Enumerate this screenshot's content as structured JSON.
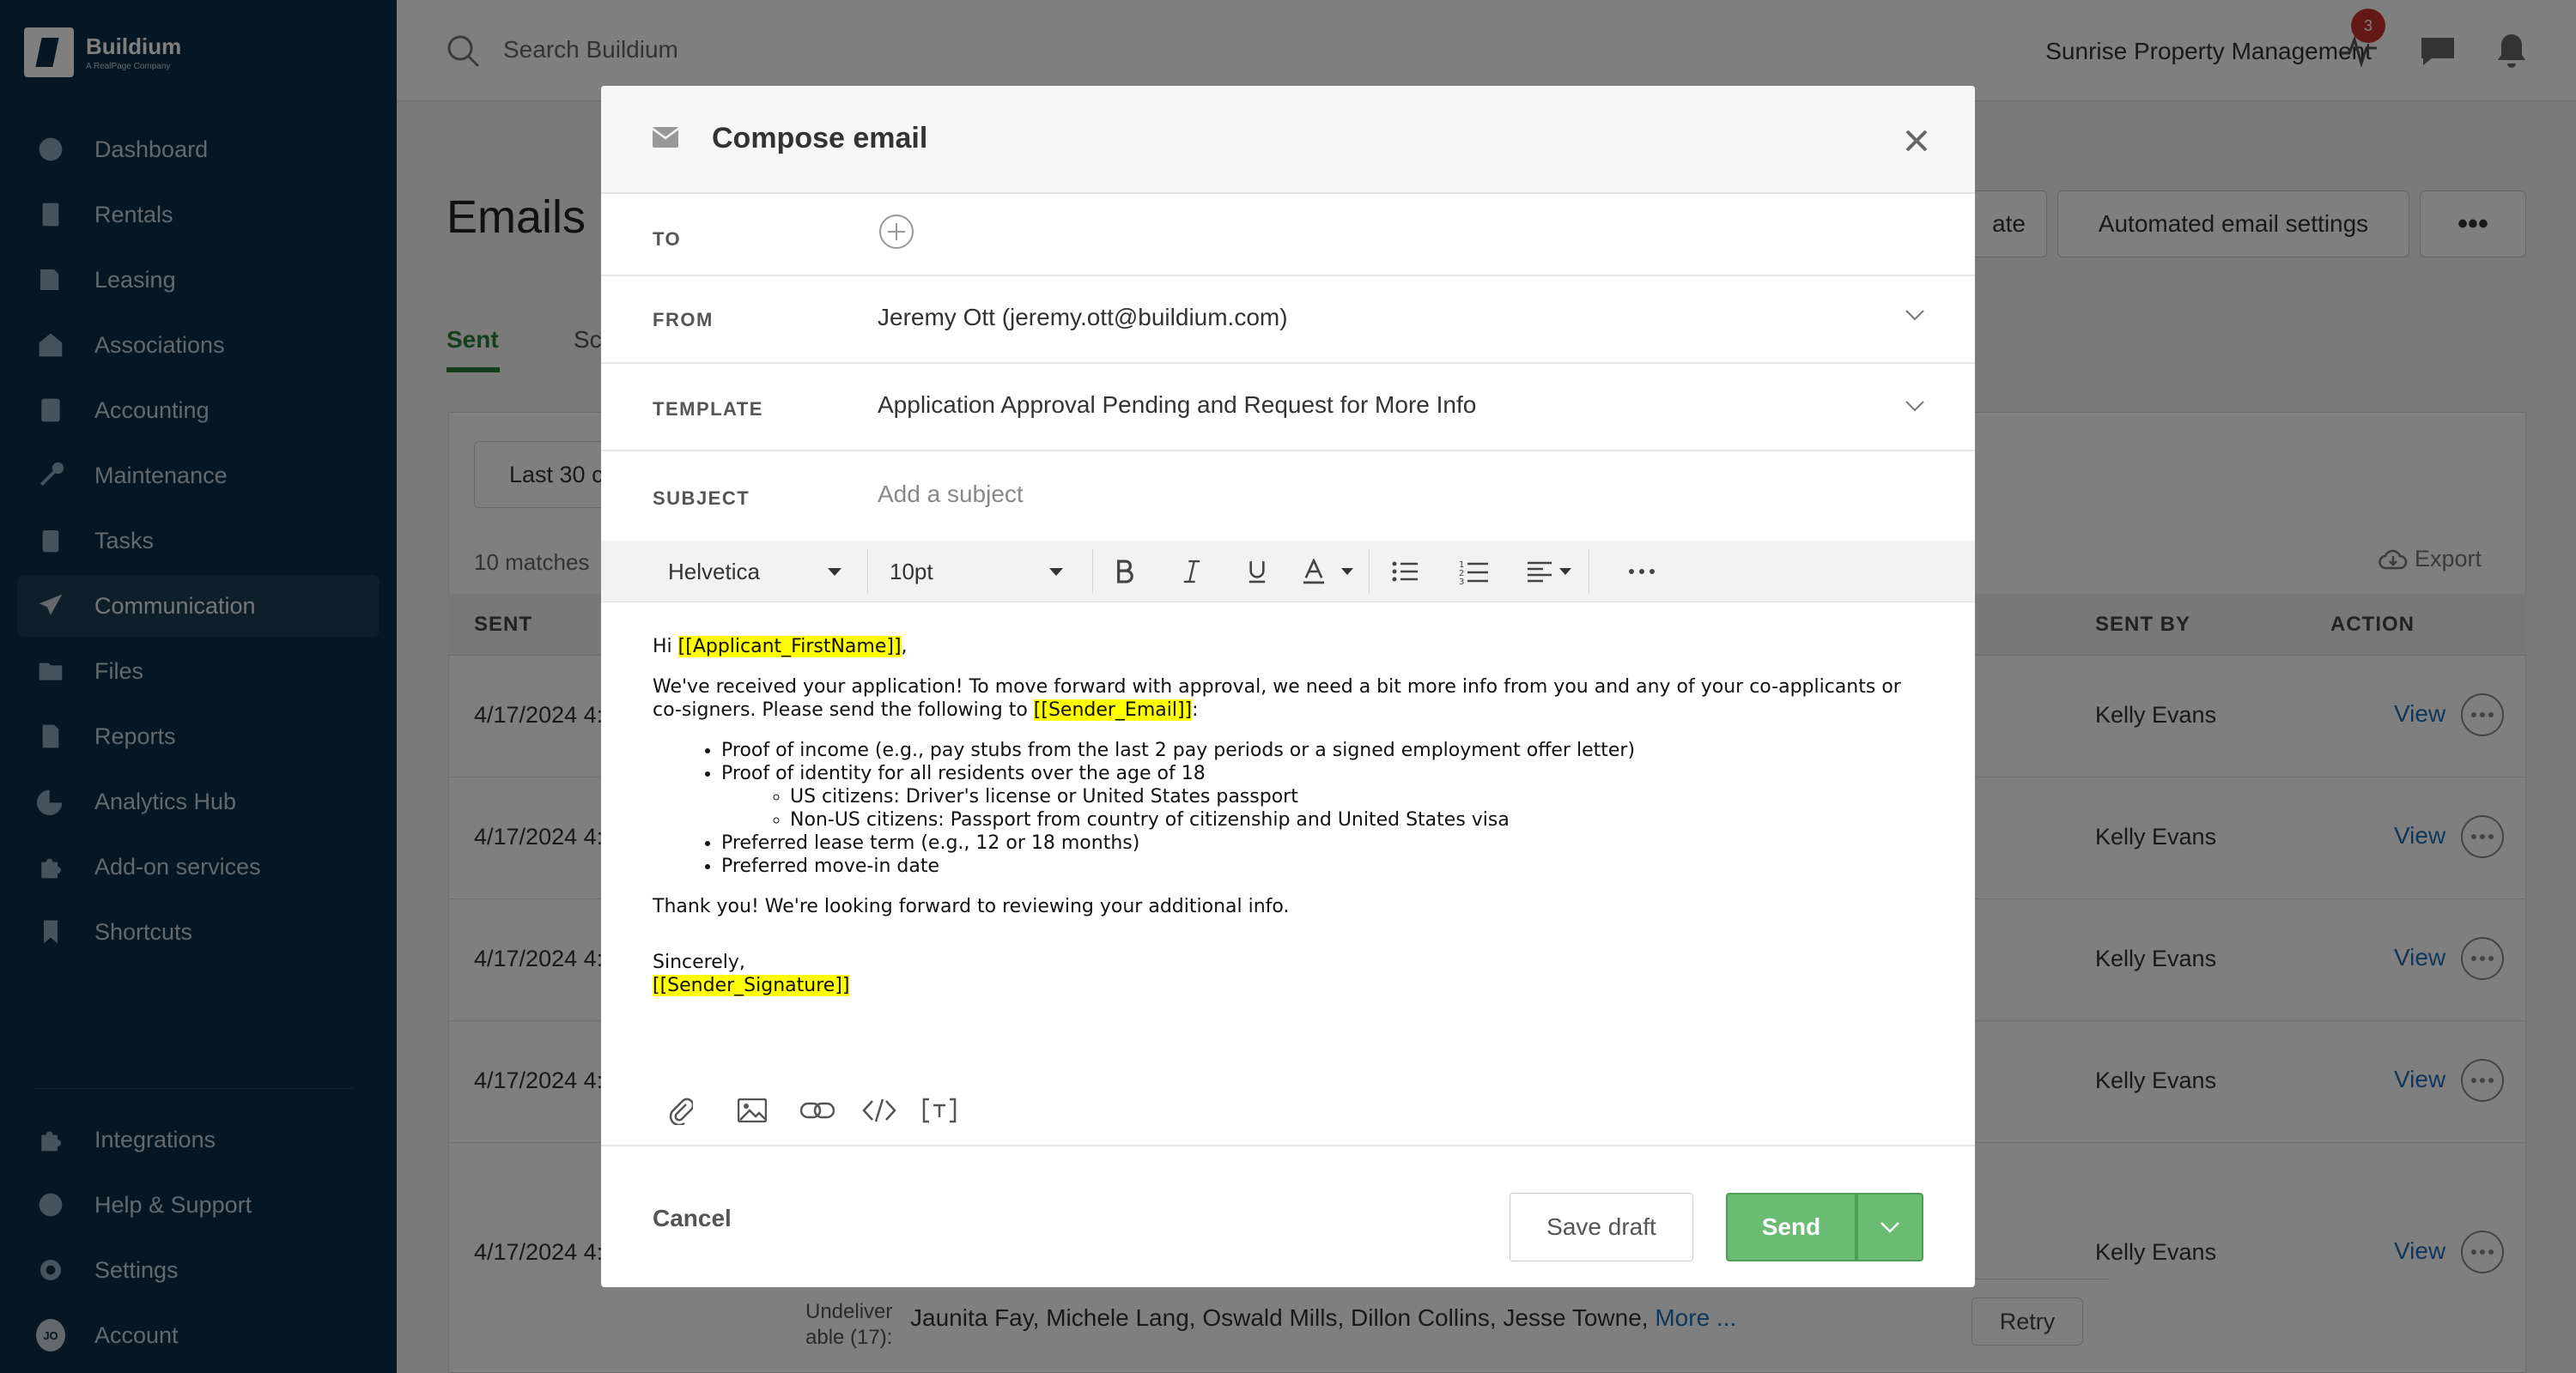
{
  "brand": {
    "name": "Buildium",
    "sub": "A RealPage Company"
  },
  "sidebar": {
    "items": [
      {
        "label": "Dashboard",
        "icon": "dashboard-icon"
      },
      {
        "label": "Rentals",
        "icon": "building-icon"
      },
      {
        "label": "Leasing",
        "icon": "leasing-icon"
      },
      {
        "label": "Associations",
        "icon": "associations-icon"
      },
      {
        "label": "Accounting",
        "icon": "calculator-icon"
      },
      {
        "label": "Maintenance",
        "icon": "wrench-icon"
      },
      {
        "label": "Tasks",
        "icon": "clipboard-icon"
      },
      {
        "label": "Communication",
        "icon": "paper-plane-icon",
        "active": true
      },
      {
        "label": "Files",
        "icon": "folder-icon"
      },
      {
        "label": "Reports",
        "icon": "report-icon"
      },
      {
        "label": "Analytics Hub",
        "icon": "pie-chart-icon"
      },
      {
        "label": "Add-on services",
        "icon": "puzzle-icon"
      },
      {
        "label": "Shortcuts",
        "icon": "bookmark-icon"
      }
    ],
    "bottom": [
      {
        "label": "Integrations",
        "icon": "puzzle-icon"
      },
      {
        "label": "Help & Support",
        "icon": "help-icon"
      },
      {
        "label": "Settings",
        "icon": "gear-icon"
      },
      {
        "label": "Account",
        "icon": "avatar",
        "initials": "JO"
      }
    ]
  },
  "header": {
    "search_placeholder": "Search Buildium",
    "org_name": "Sunrise Property Management",
    "notification_count": "3"
  },
  "page": {
    "title": "Emails",
    "btn_template_partial": "ate",
    "btn_automated": "Automated email settings",
    "tab_sent": "Sent",
    "tab_partial": "Sc",
    "filter_partial": "Last 30 c",
    "matches_partial": "10 matches",
    "export_label": "Export",
    "columns": {
      "sent": "SENT",
      "sent_by": "SENT BY",
      "action": "ACTION"
    },
    "rows": [
      {
        "sent": "4/17/2024 4:",
        "sent_by": "Kelly Evans",
        "action": "View"
      },
      {
        "sent": "4/17/2024 4:",
        "sent_by": "Kelly Evans",
        "action": "View"
      },
      {
        "sent": "4/17/2024 4:",
        "sent_by": "Kelly Evans",
        "action": "View"
      },
      {
        "sent": "4/17/2024 4:",
        "sent_by": "Kelly Evans",
        "action": "View"
      },
      {
        "sent": "4/17/2024 4:",
        "sent_by": "Kelly Evans",
        "action": "View"
      }
    ],
    "undeliverable_label": "Undeliver able (17):",
    "undeliverable_names": "Jaunita Fay, Michele Lang, Oswald Mills, Dillon Collins, Jesse Towne,",
    "undeliverable_more": "More ...",
    "retry": "Retry"
  },
  "modal": {
    "title": "Compose email",
    "to_label": "TO",
    "from_label": "FROM",
    "from_value": "Jeremy Ott (jeremy.ott@buildium.com)",
    "template_label": "TEMPLATE",
    "template_value": "Application Approval Pending and Request for More Info",
    "subject_label": "SUBJECT",
    "subject_placeholder": "Add a subject",
    "toolbar": {
      "font": "Helvetica",
      "size": "10pt"
    },
    "body": {
      "greeting_pre": "Hi ",
      "greeting_tag": "[[Applicant_FirstName]]",
      "greeting_post": ",",
      "para1": "We've received your application! To move forward with approval, we need a bit more info from you and any of your co-applicants or co-signers. Please send the following to ",
      "para1_tag": "[[Sender_Email]]",
      "para1_post": ":",
      "li1": "Proof of income (e.g., pay stubs from the last 2 pay periods or a signed employment offer letter)",
      "li2": "Proof of identity for all residents over the age of 18",
      "li2a": "US citizens: Driver's license or United States passport",
      "li2b": "Non-US citizens: Passport from country of citizenship and United States visa",
      "li3": "Preferred lease term (e.g., 12 or 18 months)",
      "li4": "Preferred move-in date",
      "thanks": "Thank you! We're looking forward to reviewing your additional info.",
      "closing": "Sincerely,",
      "signature_tag": "[[Sender_Signature]]"
    },
    "cancel": "Cancel",
    "save_draft": "Save draft",
    "send": "Send"
  },
  "colors": {
    "sidebar": "#0d2d44",
    "send": "#6abb73",
    "link": "#1f6fb2",
    "highlight": "#ffff00",
    "tab_accent": "#2a7d3a"
  }
}
